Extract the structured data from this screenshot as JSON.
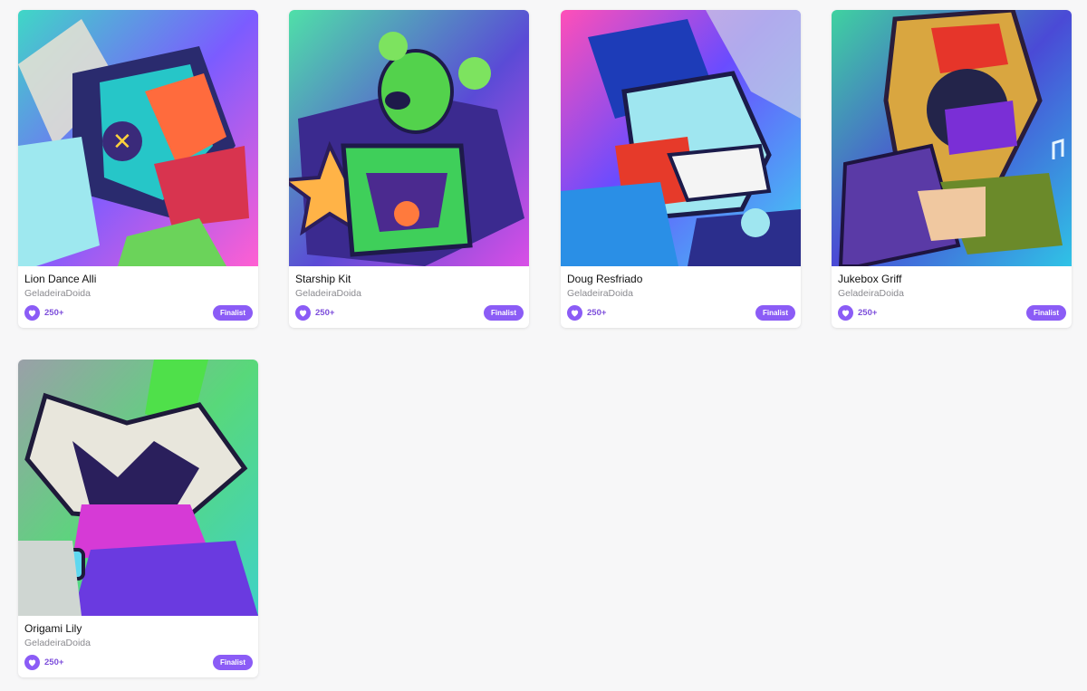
{
  "colors": {
    "accent": "#8b5cf6",
    "background": "#f7f7f8"
  },
  "icons": {
    "like": "heart-icon"
  },
  "cards": [
    {
      "title": "Lion Dance Alli",
      "author": "GeladeiraDoida",
      "likes": "250+",
      "badge": "Finalist"
    },
    {
      "title": "Starship Kit",
      "author": "GeladeiraDoida",
      "likes": "250+",
      "badge": "Finalist"
    },
    {
      "title": "Doug Resfriado",
      "author": "GeladeiraDoida",
      "likes": "250+",
      "badge": "Finalist"
    },
    {
      "title": "Jukebox Griff",
      "author": "GeladeiraDoida",
      "likes": "250+",
      "badge": "Finalist"
    },
    {
      "title": "Origami Lily",
      "author": "GeladeiraDoida",
      "likes": "250+",
      "badge": "Finalist"
    }
  ]
}
